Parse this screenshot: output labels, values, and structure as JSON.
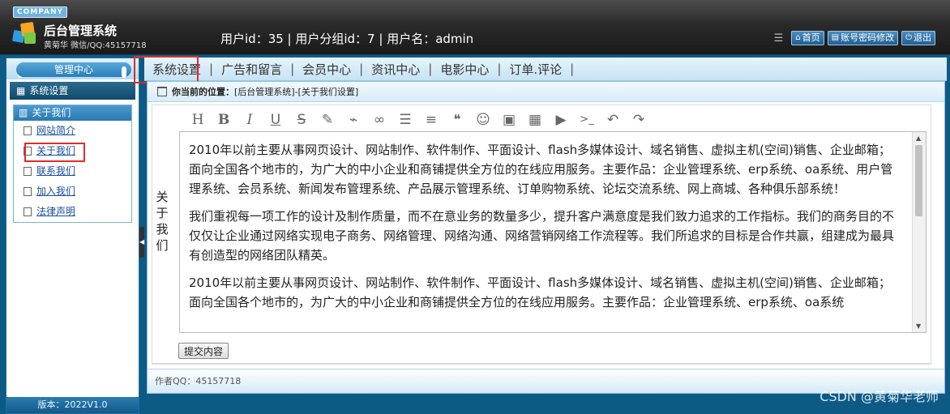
{
  "header": {
    "company": "COMPANY",
    "title": "后台管理系统",
    "subtitle": "黄菊华 微信/QQ:45157718",
    "user_info": "用户id：35 | 用户分组id：7 | 用户名：admin",
    "buttons": [
      {
        "icon": "home-icon",
        "label": "首页"
      },
      {
        "icon": "list-icon",
        "label": "账号密码修改"
      },
      {
        "icon": "power-icon",
        "label": "退出"
      }
    ]
  },
  "sidebar": {
    "center_label": "管理中心",
    "section": "系统设置",
    "group": "关于我们",
    "items": [
      {
        "label": "网站简介"
      },
      {
        "label": "关于我们"
      },
      {
        "label": "联系我们"
      },
      {
        "label": "加入我们"
      },
      {
        "label": "法律声明"
      }
    ],
    "active_item": "关于我们",
    "version": "版本：2022V1.0"
  },
  "topnav": {
    "tabs": [
      "系统设置",
      "广告和留言",
      "会员中心",
      "资讯中心",
      "电影中心",
      "订单.评论"
    ],
    "active": "系统设置"
  },
  "breadcrumb": {
    "label": "你当前的位置：",
    "path": "[后台管理系统]-[关于我们设置]"
  },
  "form": {
    "field_label": "关于我们",
    "toolbar": [
      "heading-icon",
      "bold-icon",
      "italic-icon",
      "underline-icon",
      "strikethrough-icon",
      "brush-icon",
      "paint-icon",
      "link-icon",
      "list-icon",
      "align-icon",
      "quote-icon",
      "emoji-icon",
      "image-icon",
      "table-icon",
      "video-icon",
      "code-icon",
      "undo-icon",
      "redo-icon"
    ],
    "paragraphs": [
      "2010年以前主要从事网页设计、网站制作、软件制作、平面设计、flash多媒体设计、域名销售、虚拟主机(空间)销售、企业邮箱；面向全国各个地市的，为广大的中小企业和商铺提供全方位的在线应用服务。主要作品：企业管理系统、erp系统、oa系统、用户管理系统、会员系统、新闻发布管理系统、产品展示管理系统、订单购物系统、论坛交流系统、网上商城、各种俱乐部系统！",
      "我们重视每一项工作的设计及制作质量，而不在意业务的数量多少，提升客户满意度是我们致力追求的工作指标。我们的商务目的不仅仅让企业通过网络实现电子商务、网络管理、网络沟通、网络营销网络工作流程等。我们所追求的目标是合作共赢，组建成为最具有创造型的网络团队精英。",
      "2010年以前主要从事网页设计、网站制作、软件制作、平面设计、flash多媒体设计、域名销售、虚拟主机(空间)销售、企业邮箱；面向全国各个地市的，为广大的中小企业和商铺提供全方位的在线应用服务。主要作品：企业管理系统、erp系统、oa系统"
    ],
    "submit_label": "提交内容"
  },
  "footer": {
    "author": "作者QQ：45157718"
  },
  "watermark": "CSDN @黄菊华老师"
}
